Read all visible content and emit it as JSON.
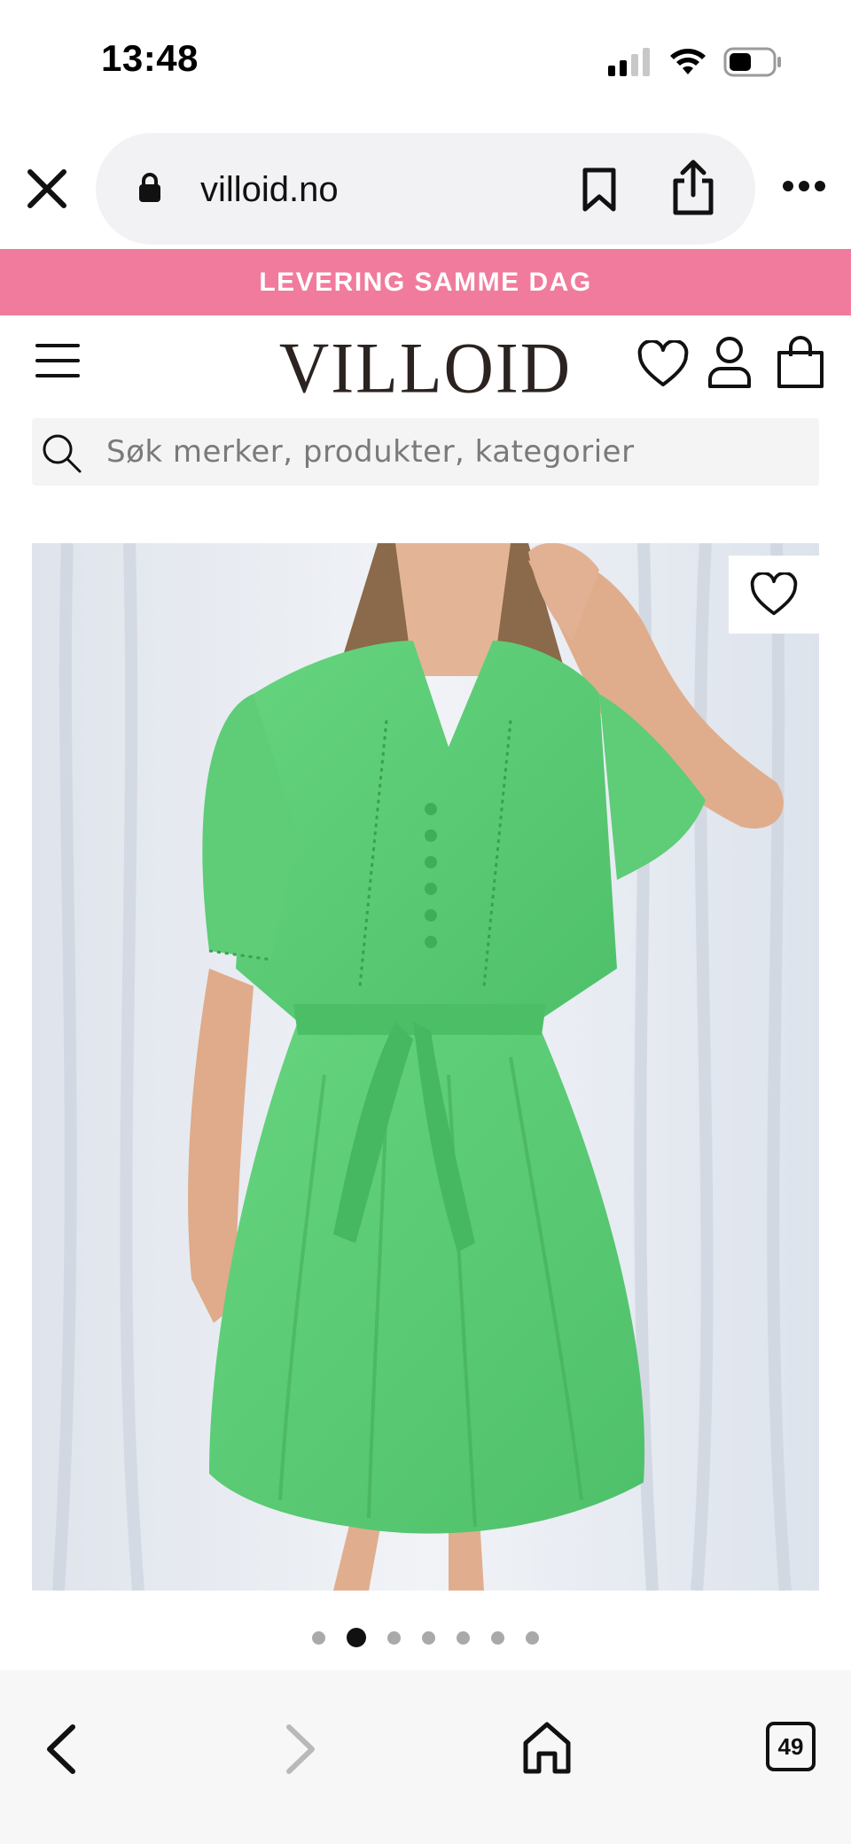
{
  "status_bar": {
    "time": "13:48",
    "icons": [
      "cellular-signal-icon",
      "wifi-icon",
      "battery-icon"
    ]
  },
  "browser": {
    "url": "villoid.no",
    "icons": [
      "close-icon",
      "lock-icon",
      "bookmark-icon",
      "share-icon",
      "more-icon"
    ]
  },
  "promo": {
    "text": "LEVERING SAMME DAG",
    "background": "#f07b9d"
  },
  "header": {
    "logo": "VILLOID",
    "icons": [
      "menu-icon",
      "heart-icon",
      "account-icon",
      "cart-icon"
    ]
  },
  "search": {
    "placeholder": "Søk merker, produkter, kategorier"
  },
  "product": {
    "image_description_icon": "product-photo",
    "carousel": {
      "total": 7,
      "active_index": 1
    }
  },
  "toolbar": {
    "tabs_count": "49",
    "icons": [
      "back-icon",
      "forward-icon",
      "home-icon",
      "tabs-icon"
    ]
  },
  "colors": {
    "accent_pink": "#f07b9d",
    "dress_green": "#5ccf74",
    "logo": "#2b2320"
  }
}
